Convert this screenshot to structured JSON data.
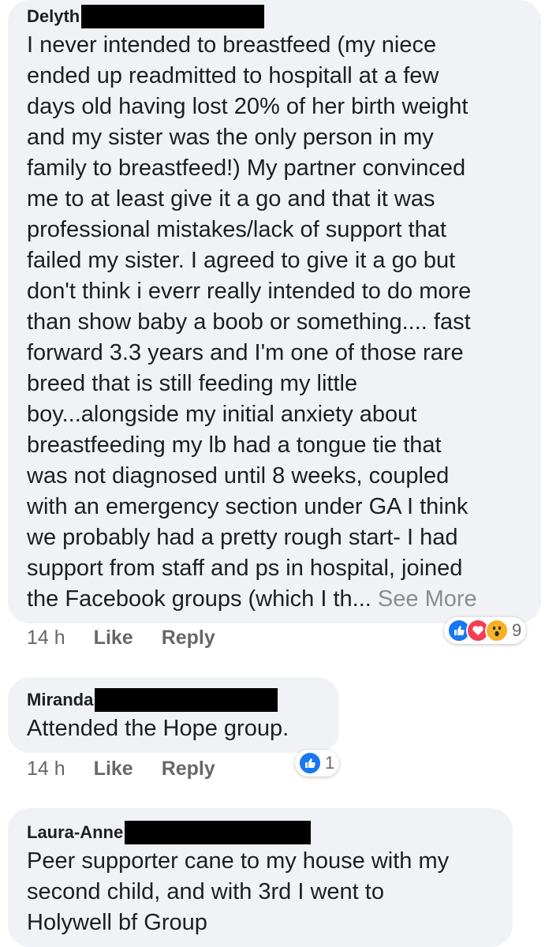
{
  "comments": [
    {
      "author": "Delyth",
      "lines": [
        "I never intended to breastfeed (my niece",
        "ended up readmitted to hospitall at a few",
        "days old having lost 20% of her birth weight",
        "and my sister was the only person in my",
        "family to breastfeed!) My partner convinced",
        "me to at least give it a go and that it was",
        "professional mistakes/lack of support that",
        "failed my sister. I agreed to give it a go but",
        "don't think i everr really intended to do more",
        "than show baby a boob or something.... fast",
        "forward 3.3 years and I'm one of those rare",
        "breed that is still feeding my little",
        "boy...alongside my initial anxiety about",
        "breastfeeding my lb had a tongue tie that",
        "was not diagnosed until 8 weeks, coupled",
        "with an emergency section under GA I think",
        "we probably had a pretty rough start- I had",
        "support from staff and ps in hospital, joined",
        "the Facebook groups (which I th..."
      ],
      "see_more": "See More",
      "time": "14 h",
      "like_label": "Like",
      "reply_label": "Reply",
      "reaction_count": "9",
      "reaction_icons": [
        "like-icon",
        "love-icon",
        "wow-icon"
      ]
    },
    {
      "author": "Miranda",
      "lines": [
        "Attended the Hope group."
      ],
      "time": "14 h",
      "like_label": "Like",
      "reply_label": "Reply",
      "reaction_count": "1",
      "reaction_icons": [
        "like-icon"
      ]
    },
    {
      "author": "Laura-Anne",
      "lines": [
        "Peer supporter cane to my house with my",
        "second child, and with 3rd I went to",
        "Holywell bf Group"
      ]
    }
  ],
  "colors": {
    "bubble": "#f0f2f5",
    "like_blue": "#1877f2",
    "love_red": "#f33e58",
    "wow_yellow": "#f7b125",
    "meta_grey": "#65676b"
  }
}
